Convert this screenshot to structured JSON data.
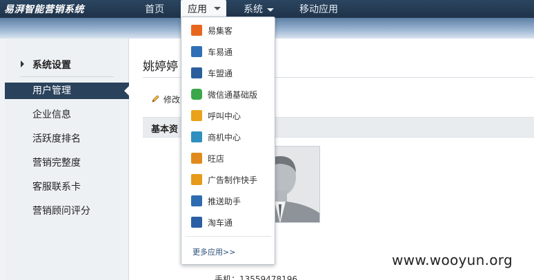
{
  "app": {
    "brand": "易湃智能营销系统"
  },
  "nav": {
    "home": "首页",
    "apps": "应用",
    "system": "系统",
    "mobile": "移动应用"
  },
  "sidebar": {
    "section_title": "系统设置",
    "items": [
      {
        "label": "用户管理",
        "active": true
      },
      {
        "label": "企业信息"
      },
      {
        "label": "活跃度排名"
      },
      {
        "label": "营销完整度"
      },
      {
        "label": "客服联系卡"
      },
      {
        "label": "营销顾问评分"
      }
    ]
  },
  "main": {
    "title": "姚婷婷",
    "edit_label": "修改",
    "section_title": "基本资",
    "phone": "手机：13559478196"
  },
  "dropdown": {
    "items": [
      {
        "label": "易集客",
        "icon": "yijike-icon",
        "color": "#e8651e"
      },
      {
        "label": "车易通",
        "icon": "cheyitong-icon",
        "color": "#2f6fb5"
      },
      {
        "label": "车盟通",
        "icon": "chemengtong-icon",
        "color": "#2c5e9e"
      },
      {
        "label": "微信通基础版",
        "icon": "wechat-icon",
        "color": "#3aa84a"
      },
      {
        "label": "呼叫中心",
        "icon": "call-center-icon",
        "color": "#e9a21a"
      },
      {
        "label": "商机中心",
        "icon": "opportunity-icon",
        "color": "#2f8fbf"
      },
      {
        "label": "旺店",
        "icon": "store-icon",
        "color": "#e08a1b"
      },
      {
        "label": "广告制作快手",
        "icon": "ad-maker-icon",
        "color": "#e59a1a"
      },
      {
        "label": "推送助手",
        "icon": "push-icon",
        "color": "#2d6bb0"
      },
      {
        "label": "淘车通",
        "icon": "taochetong-icon",
        "color": "#2a5fa3"
      }
    ],
    "more_label": "更多应用>>"
  },
  "watermark": "www.wooyun.org"
}
